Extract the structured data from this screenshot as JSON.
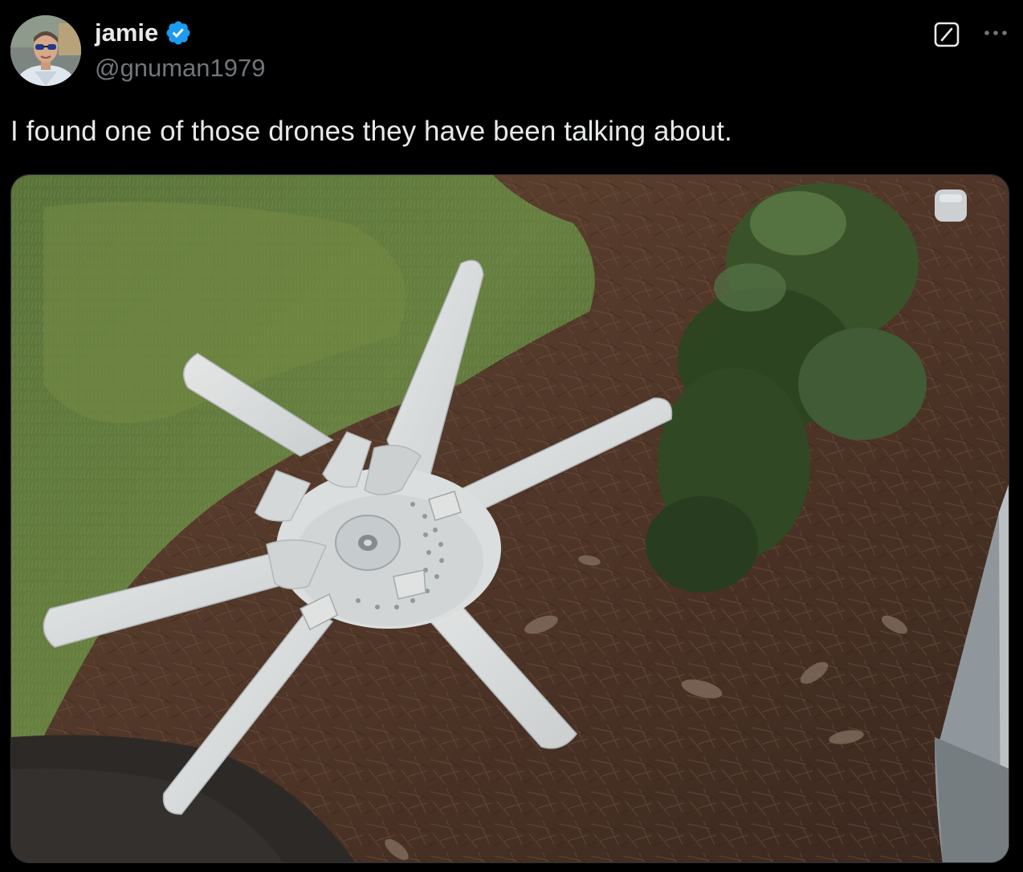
{
  "post": {
    "author": {
      "display_name": "jamie",
      "handle": "@gnuman1979",
      "verified": true
    },
    "text": "I found one of those drones they have been talking about.",
    "media": {
      "alt": "White five-blade ceiling fan lying on pine straw and grass next to a shrub"
    }
  },
  "icons": {
    "verified": "verified-badge-icon",
    "grok": "grok-icon",
    "more": "more-horizontal-icon"
  },
  "colors": {
    "background": "#000000",
    "text_primary": "#e7e9ea",
    "text_secondary": "#71767b",
    "verified_badge": "#1d9bf0",
    "border": "#2f3336"
  }
}
